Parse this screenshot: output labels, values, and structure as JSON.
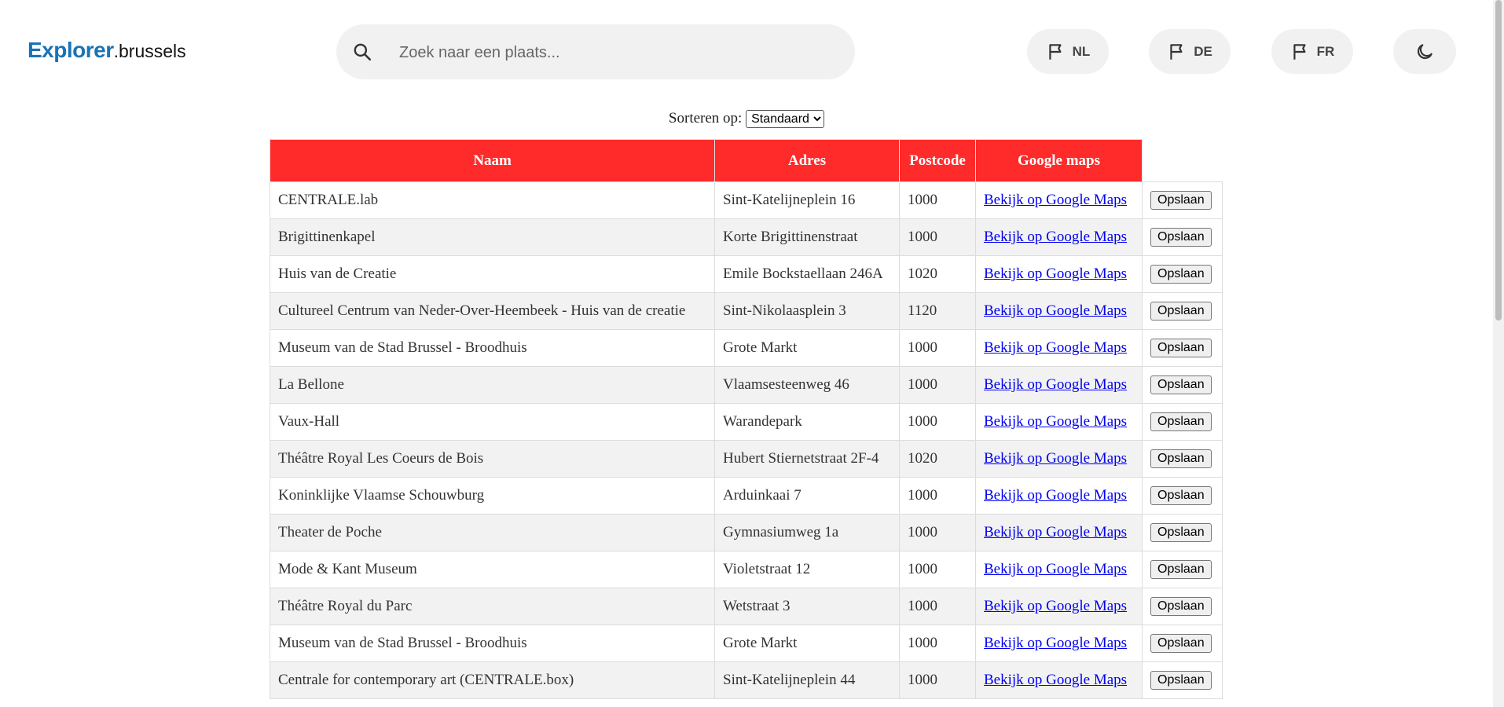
{
  "header": {
    "logo_main": "Explorer",
    "logo_sub": ".brussels",
    "search_placeholder": "Zoek naar een plaats...",
    "languages": [
      "NL",
      "DE",
      "FR"
    ]
  },
  "sort": {
    "label": "Sorteren op:",
    "selected": "Standaard"
  },
  "table": {
    "headers": [
      "Naam",
      "Adres",
      "Postcode",
      "Google maps"
    ],
    "link_text": "Bekijk op Google Maps",
    "button_text": "Opslaan",
    "rows": [
      [
        "CENTRALE.lab",
        "Sint-Katelijneplein 16",
        "1000"
      ],
      [
        "Brigittinenkapel",
        "Korte Brigittinenstraat",
        "1000"
      ],
      [
        "Huis van de Creatie",
        "Emile Bockstaellaan 246A",
        "1020"
      ],
      [
        "Cultureel Centrum van Neder-Over-Heembeek - Huis van de creatie",
        "Sint-Nikolaasplein 3",
        "1120"
      ],
      [
        "Museum van de Stad Brussel - Broodhuis",
        "Grote Markt",
        "1000"
      ],
      [
        "La Bellone",
        "Vlaamsesteenweg 46",
        "1000"
      ],
      [
        "Vaux-Hall",
        "Warandepark",
        "1000"
      ],
      [
        "Théâtre Royal Les Coeurs de Bois",
        "Hubert Stiernetstraat 2F-4",
        "1020"
      ],
      [
        "Koninklijke Vlaamse Schouwburg",
        "Arduinkaai 7",
        "1000"
      ],
      [
        "Theater de Poche",
        "Gymnasiumweg 1a",
        "1000"
      ],
      [
        "Mode & Kant Museum",
        "Violetstraat 12",
        "1000"
      ],
      [
        "Théâtre Royal du Parc",
        "Wetstraat 3",
        "1000"
      ],
      [
        "Museum van de Stad Brussel - Broodhuis",
        "Grote Markt",
        "1000"
      ],
      [
        "Centrale for contemporary art (CENTRALE.box)",
        "Sint-Katelijneplein 44",
        "1000"
      ]
    ]
  },
  "colors": {
    "brand": "#1a73b5",
    "header_red": "#ff2a2a",
    "link": "#0000ee"
  }
}
